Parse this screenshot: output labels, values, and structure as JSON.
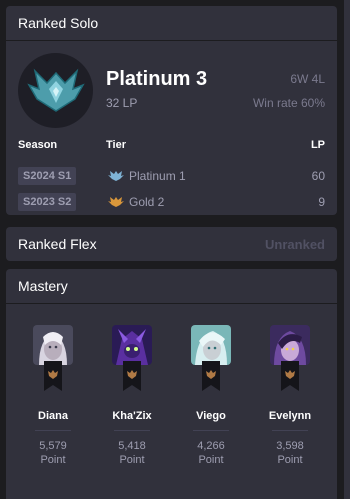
{
  "ranked_solo": {
    "title": "Ranked Solo",
    "tier": "Platinum 3",
    "lp": "32 LP",
    "record": "6W 4L",
    "win_rate": "Win rate 60%",
    "headers": {
      "season": "Season",
      "tier": "Tier",
      "lp": "LP"
    },
    "seasons": [
      {
        "season": "S2024 S1",
        "tier": "Platinum 1",
        "lp": "60",
        "tier_color": "#7fb3d5"
      },
      {
        "season": "S2023 S2",
        "tier": "Gold 2",
        "lp": "9",
        "tier_color": "#d9973b"
      }
    ]
  },
  "ranked_flex": {
    "title": "Ranked Flex",
    "status": "Unranked"
  },
  "mastery": {
    "title": "Mastery",
    "champions": [
      {
        "name": "Diana",
        "points": "5,579",
        "unit": "Point"
      },
      {
        "name": "Kha'Zix",
        "points": "5,418",
        "unit": "Point"
      },
      {
        "name": "Viego",
        "points": "4,266",
        "unit": "Point"
      },
      {
        "name": "Evelynn",
        "points": "3,598",
        "unit": "Point"
      }
    ]
  },
  "colors": {
    "background": "#1c1c1f",
    "card": "#31313c",
    "muted_text": "#9e9eb1",
    "dim_text": "#515163"
  }
}
